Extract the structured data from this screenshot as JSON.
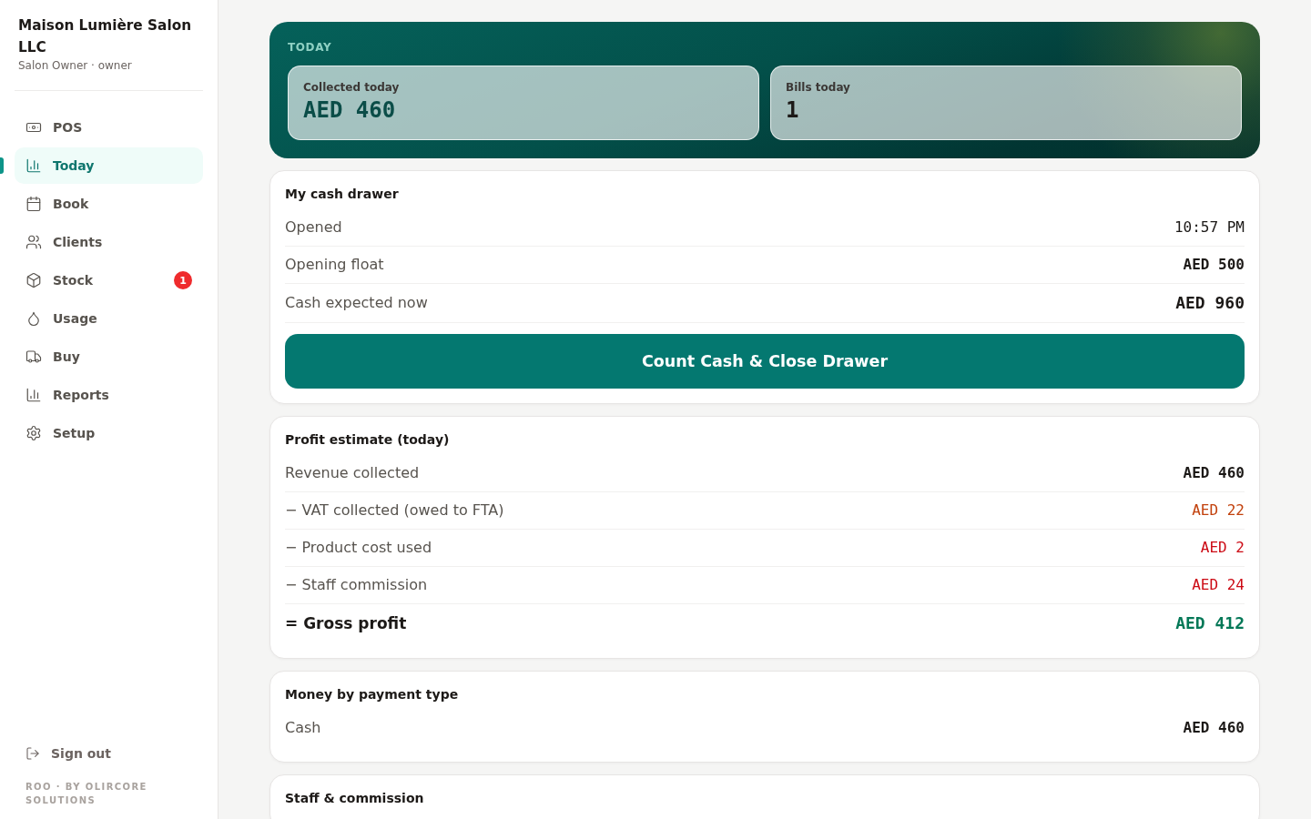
{
  "sidebar": {
    "business_name": "Maison Lumière Salon LLC",
    "user_line": "Salon Owner · owner",
    "nav_items": [
      {
        "label": "POS",
        "selected": false
      },
      {
        "label": "Today",
        "selected": true
      },
      {
        "label": "Book",
        "selected": false
      },
      {
        "label": "Clients",
        "selected": false
      },
      {
        "label": "Stock",
        "selected": false,
        "badge": "1"
      },
      {
        "label": "Usage",
        "selected": false
      },
      {
        "label": "Buy",
        "selected": false
      },
      {
        "label": "Reports",
        "selected": false
      },
      {
        "label": "Setup",
        "selected": false
      }
    ],
    "sign_out": "Sign out",
    "footer": "ROO · BY OLIRCORE SOLUTIONS"
  },
  "today": {
    "heading": "TODAY",
    "stats": [
      {
        "label": "Collected today",
        "value": "AED 460",
        "kind": "amount"
      },
      {
        "label": "Bills today",
        "value": "1",
        "kind": "count"
      }
    ]
  },
  "cash_drawer": {
    "title": "My cash drawer",
    "rows": [
      {
        "label": "Opened",
        "value": "10:57 PM",
        "kind": "plain"
      },
      {
        "label": "Opening float",
        "value": "AED 500",
        "kind": "strong"
      },
      {
        "label": "Cash expected now",
        "value": "AED 960",
        "kind": "total"
      }
    ],
    "button": "Count Cash & Close Drawer"
  },
  "profit_estimate": {
    "title": "Profit estimate (today)",
    "rows": [
      {
        "label": "Revenue collected",
        "value": "AED 460",
        "kind": "strong"
      },
      {
        "label": "− VAT collected (owed to FTA)",
        "value": "AED 22",
        "kind": "tax"
      },
      {
        "label": "− Product cost used",
        "value": "AED 2",
        "kind": "cost"
      },
      {
        "label": "− Staff commission",
        "value": "AED 24",
        "kind": "cost"
      },
      {
        "label": "= Gross profit",
        "value": "AED 412",
        "kind": "result"
      }
    ]
  },
  "payment_types": {
    "title": "Money by payment type",
    "rows": [
      {
        "label": "Cash",
        "value": "AED 460",
        "kind": "strong"
      }
    ]
  },
  "staff_commission": {
    "title": "Staff & commission"
  }
}
